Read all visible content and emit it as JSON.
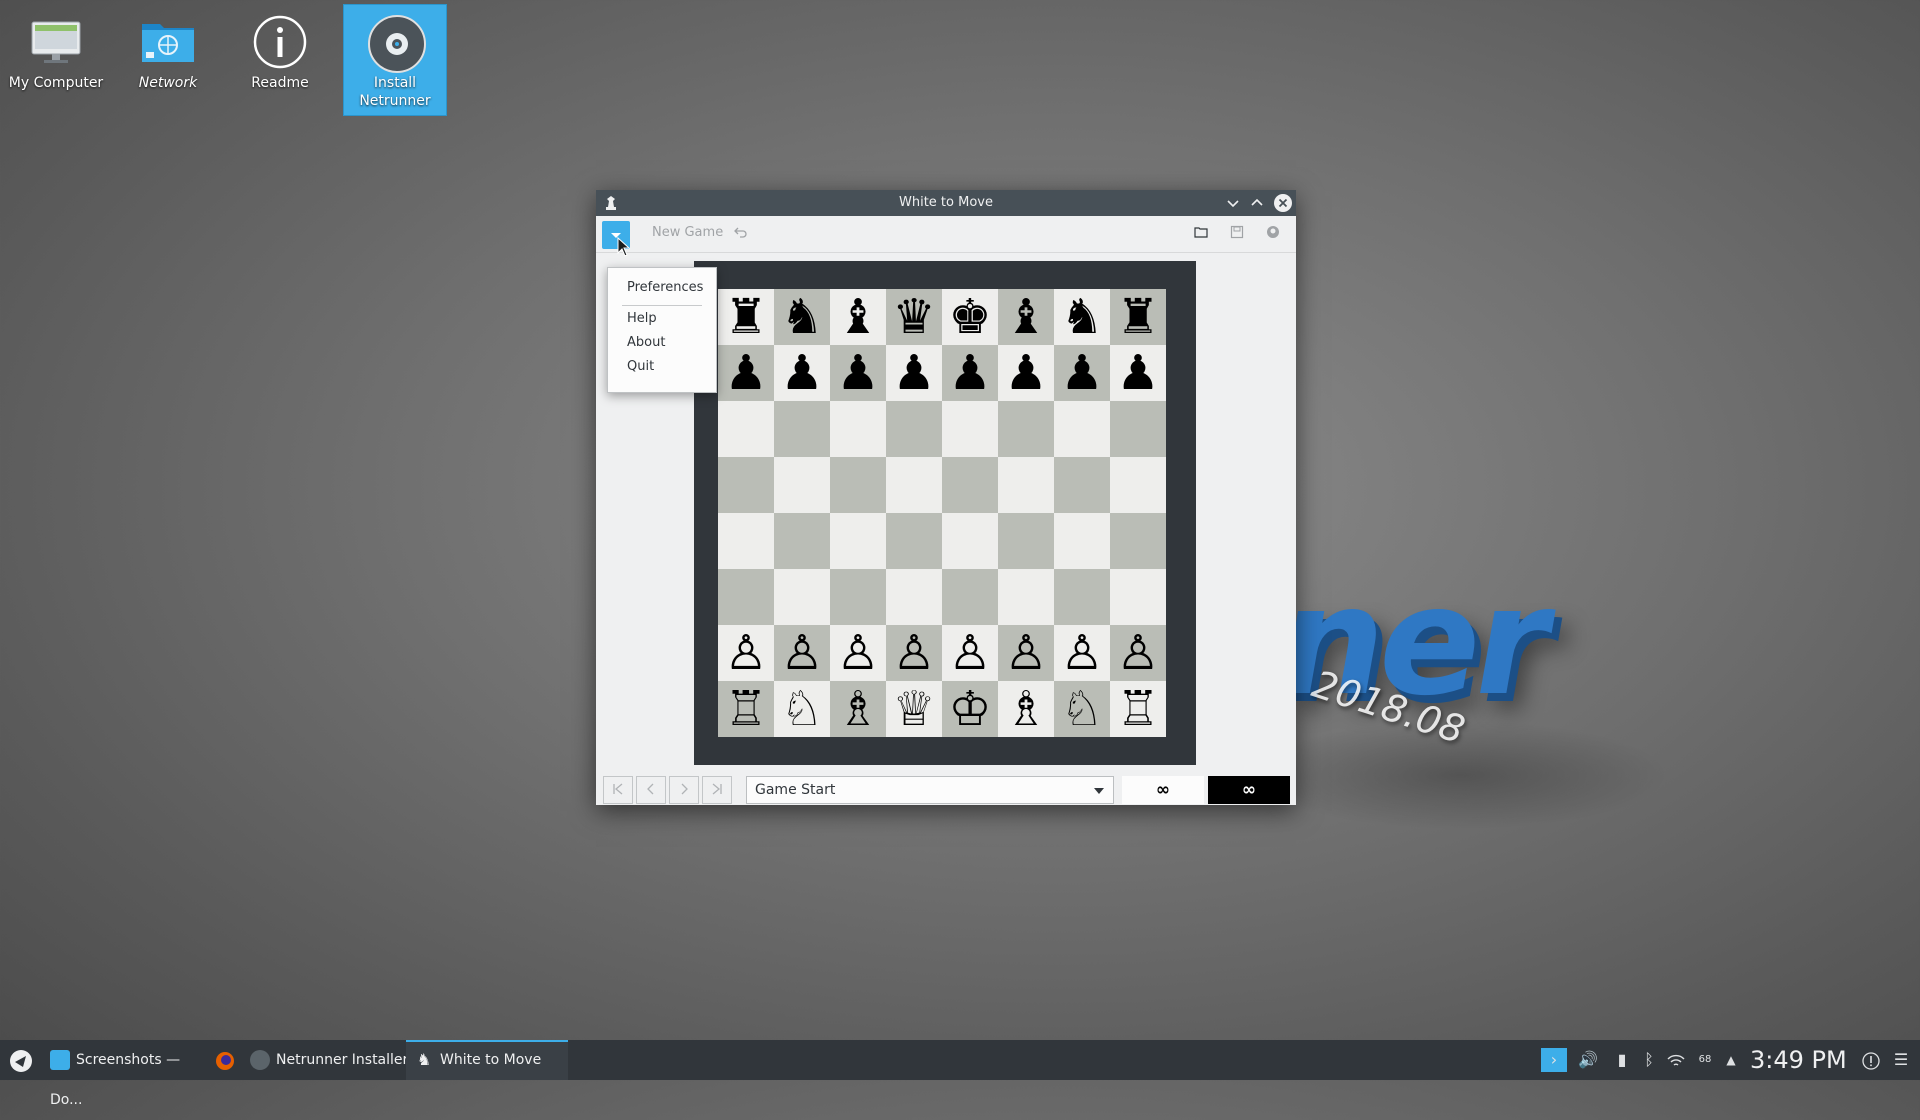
{
  "desktop": {
    "icons": [
      {
        "label": "My Computer"
      },
      {
        "label": "Network"
      },
      {
        "label": "Readme"
      },
      {
        "label_line1": "Install",
        "label_line2": "Netrunner"
      }
    ],
    "wallpaper_text": "2018.08"
  },
  "window": {
    "title": "White to Move",
    "toolbar": {
      "new_game_label": "New Game"
    },
    "menu": {
      "items": [
        "Preferences",
        "Help",
        "About",
        "Quit"
      ]
    },
    "board": {
      "ranks": [
        [
          "♜",
          "♞",
          "♝",
          "♛",
          "♚",
          "♝",
          "♞",
          "♜"
        ],
        [
          "♟",
          "♟",
          "♟",
          "♟",
          "♟",
          "♟",
          "♟",
          "♟"
        ],
        [
          "",
          "",
          "",
          "",
          "",
          "",
          "",
          ""
        ],
        [
          "",
          "",
          "",
          "",
          "",
          "",
          "",
          ""
        ],
        [
          "",
          "",
          "",
          "",
          "",
          "",
          "",
          ""
        ],
        [
          "",
          "",
          "",
          "",
          "",
          "",
          "",
          ""
        ],
        [
          "♙",
          "♙",
          "♙",
          "♙",
          "♙",
          "♙",
          "♙",
          "♙"
        ],
        [
          "♖",
          "♘",
          "♗",
          "♕",
          "♔",
          "♗",
          "♘",
          "♖"
        ]
      ]
    },
    "bottom": {
      "move_select_value": "Game Start",
      "white_clock": "∞",
      "black_clock": "∞"
    }
  },
  "taskbar": {
    "items": [
      "Screenshots — Do...",
      "Netrunner Installer",
      "White to Move"
    ],
    "battery": "68",
    "time": "3:49 PM"
  },
  "colors": {
    "accent": "#3daee9",
    "titlebar": "#475057",
    "taskbar": "#31363b",
    "board_light": "#eeeeec",
    "board_dark": "#babdb6"
  }
}
